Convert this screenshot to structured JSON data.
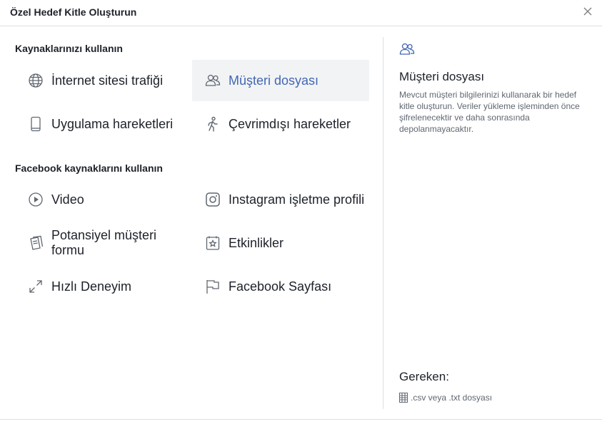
{
  "dialog": {
    "title": "Özel Hedef Kitle Oluşturun",
    "close_icon": "close-icon"
  },
  "sections": [
    {
      "title": "Kaynaklarınızı kullanın"
    },
    {
      "title": "Facebook kaynaklarını kullanın"
    }
  ],
  "options": {
    "website_traffic": {
      "label": "İnternet sitesi trafiği",
      "icon": "globe-icon"
    },
    "customer_file": {
      "label": "Müşteri dosyası",
      "icon": "people-icon",
      "selected": true
    },
    "app_activity": {
      "label": "Uygulama hareketleri",
      "icon": "mobile-icon"
    },
    "offline_activity": {
      "label": "Çevrimdışı hareketler",
      "icon": "walking-person-icon"
    },
    "video": {
      "label": "Video",
      "icon": "play-icon"
    },
    "instagram": {
      "label": "Instagram işletme profili",
      "icon": "instagram-icon"
    },
    "lead_form": {
      "label": "Potansiyel müşteri formu",
      "icon": "form-icon"
    },
    "events": {
      "label": "Etkinlikler",
      "icon": "star-calendar-icon"
    },
    "instant_experience": {
      "label": "Hızlı Deneyim",
      "icon": "expand-icon"
    },
    "facebook_page": {
      "label": "Facebook Sayfası",
      "icon": "flag-icon"
    }
  },
  "detail": {
    "icon": "people-icon",
    "title": "Müşteri dosyası",
    "description": "Mevcut müşteri bilgilerinizi kullanarak bir hedef kitle oluşturun. Veriler yükleme işleminden önce şifrelenecektir ve daha sonrasında depolanmayacaktır.",
    "requirements_label": "Gereken:",
    "file_requirement": ".csv veya .txt dosyası",
    "file_icon": "spreadsheet-icon"
  },
  "colors": {
    "accent": "#4267b2",
    "selected_bg": "#f2f3f5",
    "divider": "#dddfe2",
    "text": "#1d2129",
    "muted_text": "#606770",
    "icon": "#606770"
  }
}
